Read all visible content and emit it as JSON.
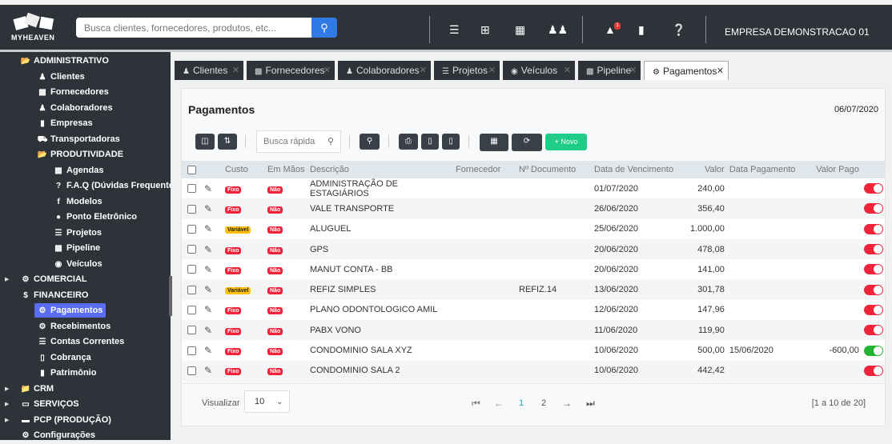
{
  "header": {
    "logo_text": "MYHEAVEN",
    "search_placeholder": "Busca clientes, fornecedores, produtos, etc...",
    "notification_count": "1",
    "company": "EMPRESA DEMONSTRACAO 01",
    "icons": [
      "menu-icon",
      "plus-square-icon",
      "calendar-icon",
      "users-icon",
      "bell-icon",
      "building-icon",
      "help-icon"
    ]
  },
  "sidebar": {
    "items": [
      {
        "label": "ADMINISTRATIVO",
        "level": 0,
        "icon": "folder-open-icon",
        "expanded": true
      },
      {
        "label": "Clientes",
        "level": 1,
        "icon": "users-icon"
      },
      {
        "label": "Fornecedores",
        "level": 1,
        "icon": "boxes-icon"
      },
      {
        "label": "Colaboradores",
        "level": 1,
        "icon": "users-icon"
      },
      {
        "label": "Empresas",
        "level": 1,
        "icon": "building-icon"
      },
      {
        "label": "Transportadoras",
        "level": 1,
        "icon": "truck-icon"
      },
      {
        "label": "PRODUTIVIDADE",
        "level": 1,
        "icon": "folder-open-icon"
      },
      {
        "label": "Agendas",
        "level": 2,
        "icon": "calendar-icon"
      },
      {
        "label": "F.A.Q (Dúvidas Frequentes)",
        "level": 2,
        "icon": "question-icon"
      },
      {
        "label": "Modelos",
        "level": 2,
        "icon": "font-icon"
      },
      {
        "label": "Ponto Eletrônico",
        "level": 2,
        "icon": "clock-icon"
      },
      {
        "label": "Projetos",
        "level": 2,
        "icon": "tasks-icon"
      },
      {
        "label": "Pipeline",
        "level": 2,
        "icon": "pipeline-icon"
      },
      {
        "label": "Veículos",
        "level": 2,
        "icon": "car-icon"
      },
      {
        "label": "COMERCIAL",
        "level": 0,
        "icon": "gear-icon",
        "collapsed": true
      },
      {
        "label": "FINANCEIRO",
        "level": 0,
        "icon": "dollar-icon",
        "expanded": true
      },
      {
        "label": "Pagamentos",
        "level": 1,
        "icon": "gear-icon",
        "active": true
      },
      {
        "label": "Recebimentos",
        "level": 1,
        "icon": "gear-icon"
      },
      {
        "label": "Contas Correntes",
        "level": 1,
        "icon": "list-icon"
      },
      {
        "label": "Cobrança",
        "level": 1,
        "icon": "file-icon"
      },
      {
        "label": "Patrimônio",
        "level": 1,
        "icon": "building-icon"
      },
      {
        "label": "CRM",
        "level": 0,
        "icon": "folder-icon",
        "collapsed": true
      },
      {
        "label": "SERVIÇOS",
        "level": 0,
        "icon": "desktop-icon",
        "collapsed": true
      },
      {
        "label": "PCP (PRODUÇÃO)",
        "level": 0,
        "icon": "industry-icon",
        "collapsed": true
      },
      {
        "label": "Configurações",
        "level": 0,
        "icon": "gear-icon"
      }
    ]
  },
  "tabs": [
    {
      "label": "Clientes",
      "icon": "users-icon"
    },
    {
      "label": "Fornecedores",
      "icon": "boxes-icon"
    },
    {
      "label": "Colaboradores",
      "icon": "users-icon"
    },
    {
      "label": "Projetos",
      "icon": "tasks-icon"
    },
    {
      "label": "Veículos",
      "icon": "car-icon"
    },
    {
      "label": "Pipeline",
      "icon": "pipeline-icon"
    },
    {
      "label": "Pagamentos",
      "icon": "gear-icon",
      "active": true
    }
  ],
  "page": {
    "title": "Pagamentos",
    "date": "06/07/2020",
    "quick_search_placeholder": "Busca rápida",
    "new_label": "Novo"
  },
  "table": {
    "columns": [
      "Custo",
      "Em Mãos",
      "Descrição",
      "Fornecedor",
      "Nº Documento",
      "Data de Vencimento",
      "Valor",
      "Data Pagamento",
      "Valor Pago"
    ],
    "rows": [
      {
        "custo": "Fixo",
        "em_maos": "Não",
        "descricao": "ADMINISTRAÇÃO DE ESTAGIÁRIOS",
        "fornecedor": "",
        "documento": "",
        "vencimento": "01/07/2020",
        "valor": "240,00",
        "data_pagamento": "",
        "valor_pago": "",
        "pago": false
      },
      {
        "custo": "Fixo",
        "em_maos": "Não",
        "descricao": "VALE TRANSPORTE",
        "fornecedor": "",
        "documento": "",
        "vencimento": "26/06/2020",
        "valor": "356,40",
        "data_pagamento": "",
        "valor_pago": "",
        "pago": false
      },
      {
        "custo": "Variável",
        "em_maos": "Não",
        "descricao": "ALUGUEL",
        "fornecedor": "",
        "documento": "",
        "vencimento": "25/06/2020",
        "valor": "1.000,00",
        "data_pagamento": "",
        "valor_pago": "",
        "pago": false
      },
      {
        "custo": "Fixo",
        "em_maos": "Não",
        "descricao": "GPS",
        "fornecedor": "",
        "documento": "",
        "vencimento": "20/06/2020",
        "valor": "478,08",
        "data_pagamento": "",
        "valor_pago": "",
        "pago": false
      },
      {
        "custo": "Fixo",
        "em_maos": "Não",
        "descricao": "MANUT CONTA - BB",
        "fornecedor": "",
        "documento": "",
        "vencimento": "20/06/2020",
        "valor": "141,00",
        "data_pagamento": "",
        "valor_pago": "",
        "pago": false
      },
      {
        "custo": "Variável",
        "em_maos": "Não",
        "descricao": "REFIZ SIMPLES",
        "fornecedor": "",
        "documento": "REFIZ.14",
        "vencimento": "13/06/2020",
        "valor": "301,78",
        "data_pagamento": "",
        "valor_pago": "",
        "pago": false
      },
      {
        "custo": "Fixo",
        "em_maos": "Não",
        "descricao": "PLANO ODONTOLOGICO AMIL",
        "fornecedor": "",
        "documento": "",
        "vencimento": "12/06/2020",
        "valor": "147,96",
        "data_pagamento": "",
        "valor_pago": "",
        "pago": false
      },
      {
        "custo": "Fixo",
        "em_maos": "Não",
        "descricao": "PABX VONO",
        "fornecedor": "",
        "documento": "",
        "vencimento": "11/06/2020",
        "valor": "119,90",
        "data_pagamento": "",
        "valor_pago": "",
        "pago": false
      },
      {
        "custo": "Fixo",
        "em_maos": "Não",
        "descricao": "CONDOMINIO SALA XYZ",
        "fornecedor": "",
        "documento": "",
        "vencimento": "10/06/2020",
        "valor": "500,00",
        "data_pagamento": "15/06/2020",
        "valor_pago": "-600,00",
        "pago": true
      },
      {
        "custo": "Fixo",
        "em_maos": "Não",
        "descricao": "CONDOMINIO SALA 2",
        "fornecedor": "",
        "documento": "",
        "vencimento": "10/06/2020",
        "valor": "442,42",
        "data_pagamento": "",
        "valor_pago": "",
        "pago": false
      }
    ]
  },
  "footer": {
    "visualizar_label": "Visualizar",
    "page_size": "10",
    "pages": [
      "1",
      "2"
    ],
    "current_page": "1",
    "range": "[1 a 10 de 20]"
  },
  "colors": {
    "topbar": "#2e333a",
    "accent": "#2f7ae5",
    "active_sidebar": "#5a6cf0",
    "new_button": "#1fcd87",
    "tag_red": "#f0233a",
    "tag_yellow": "#ffc107",
    "toggle_on": "#21b532"
  }
}
